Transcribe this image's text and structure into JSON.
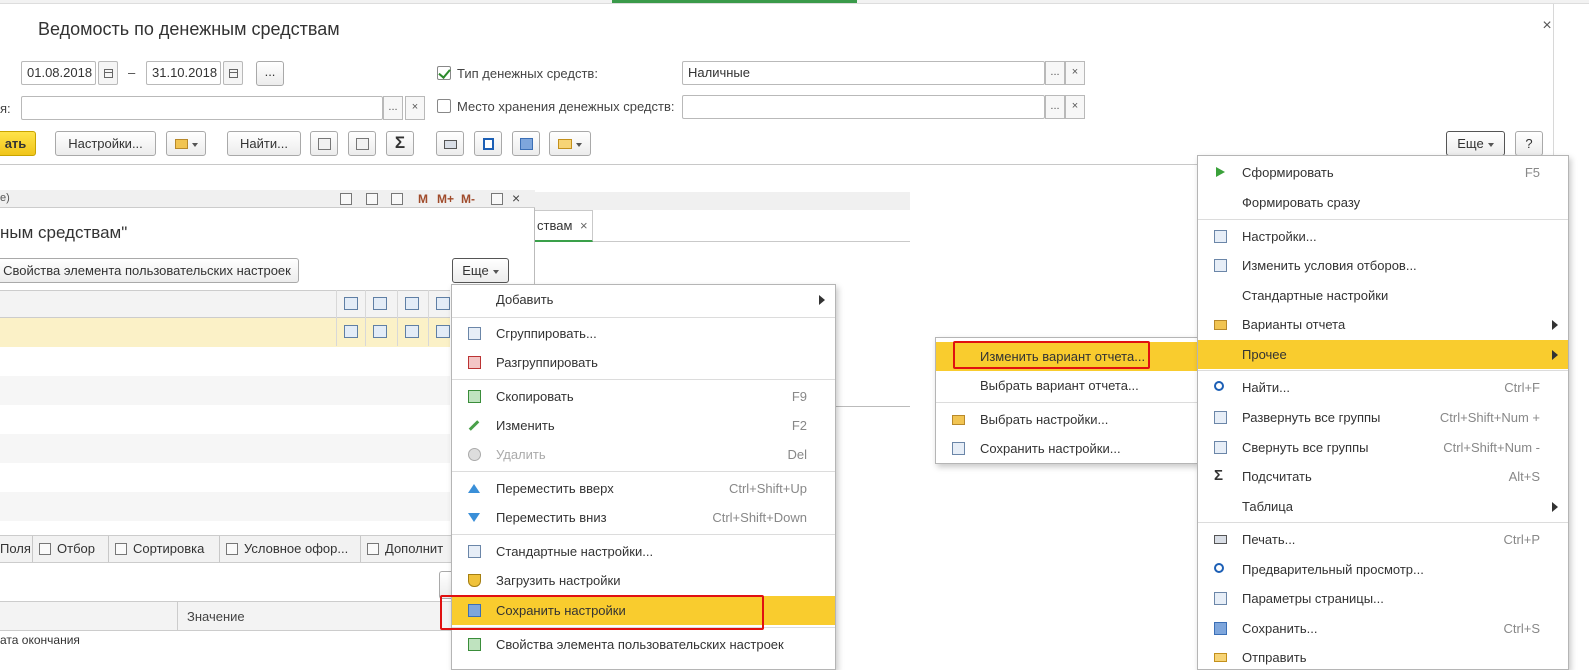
{
  "window": {
    "title": "Ведомость по денежным средствам",
    "close": "×"
  },
  "filters": {
    "date_from": "01.08.2018",
    "date_dash": "–",
    "date_to": "31.10.2018",
    "period_btn": "...",
    "row2_label": "я:",
    "cash_type_label": "Тип денежных средств:",
    "cash_type_value": "Наличные",
    "cash_type_checked": true,
    "storage_label": "Место хранения денежных средств:",
    "storage_value": "",
    "storage_checked": false,
    "choose_btn": "...",
    "clear_btn": "×"
  },
  "toolbar": {
    "generate": "ать",
    "settings": "Настройки...",
    "find": "Найти...",
    "sum_glyph": "Σ",
    "more": "Еще",
    "help": "?"
  },
  "inner": {
    "bar_text": "е)",
    "m": "M",
    "mplus": "M+",
    "mminus": "M-",
    "title": "ным средствам\"",
    "props_button": "Свойства элемента пользовательских настроек",
    "more": "Еще",
    "tabs": [
      "Поля",
      "Отбор",
      "Сортировка",
      "Условное офор...",
      "Дополнит"
    ],
    "param_value_header": "Значение",
    "param_row": "ата окончания"
  },
  "background": {
    "tab_label": "ствам",
    "tab_close": "×"
  },
  "menu_left": {
    "items": [
      {
        "label": "Добавить",
        "key": "",
        "submenu": true
      },
      {
        "label": "Сгруппировать...",
        "key": ""
      },
      {
        "label": "Разгруппировать",
        "key": ""
      },
      {
        "label": "Скопировать",
        "key": "F9"
      },
      {
        "label": "Изменить",
        "key": "F2"
      },
      {
        "label": "Удалить",
        "key": "Del",
        "disabled": true
      },
      {
        "label": "Переместить вверх",
        "key": "Ctrl+Shift+Up"
      },
      {
        "label": "Переместить вниз",
        "key": "Ctrl+Shift+Down"
      },
      {
        "label": "Стандартные настройки...",
        "key": ""
      },
      {
        "label": "Загрузить настройки",
        "key": ""
      },
      {
        "label": "Сохранить настройки",
        "key": "",
        "highlighted": true
      },
      {
        "label": "Свойства элемента пользовательских настроек",
        "key": ""
      }
    ]
  },
  "menu_mid": {
    "items": [
      {
        "label": "Изменить вариант отчета...",
        "highlighted": true
      },
      {
        "label": "Выбрать вариант отчета..."
      },
      {
        "label": "Выбрать настройки..."
      },
      {
        "label": "Сохранить настройки..."
      }
    ]
  },
  "menu_right": {
    "items": [
      {
        "label": "Сформировать",
        "key": "F5"
      },
      {
        "label": "Формировать сразу",
        "key": ""
      },
      {
        "label": "Настройки...",
        "key": ""
      },
      {
        "label": "Изменить условия отборов...",
        "key": ""
      },
      {
        "label": "Стандартные настройки",
        "key": ""
      },
      {
        "label": "Варианты отчета",
        "key": "",
        "submenu": true
      },
      {
        "label": "Прочее",
        "key": "",
        "submenu": true,
        "highlighted": true
      },
      {
        "label": "Найти...",
        "key": "Ctrl+F"
      },
      {
        "label": "Развернуть все группы",
        "key": "Ctrl+Shift+Num +"
      },
      {
        "label": "Свернуть все группы",
        "key": "Ctrl+Shift+Num -"
      },
      {
        "label": "Подсчитать",
        "key": "Alt+S"
      },
      {
        "label": "Таблица",
        "key": "",
        "submenu": true
      },
      {
        "label": "Печать...",
        "key": "Ctrl+P"
      },
      {
        "label": "Предварительный просмотр...",
        "key": ""
      },
      {
        "label": "Параметры страницы...",
        "key": ""
      },
      {
        "label": "Сохранить...",
        "key": "Ctrl+S"
      },
      {
        "label": "Отправить",
        "key": ""
      }
    ]
  },
  "colors": {
    "highlight": "#f9cc2e",
    "red_frame": "#e01010",
    "accent_green": "#3a9a4a"
  }
}
